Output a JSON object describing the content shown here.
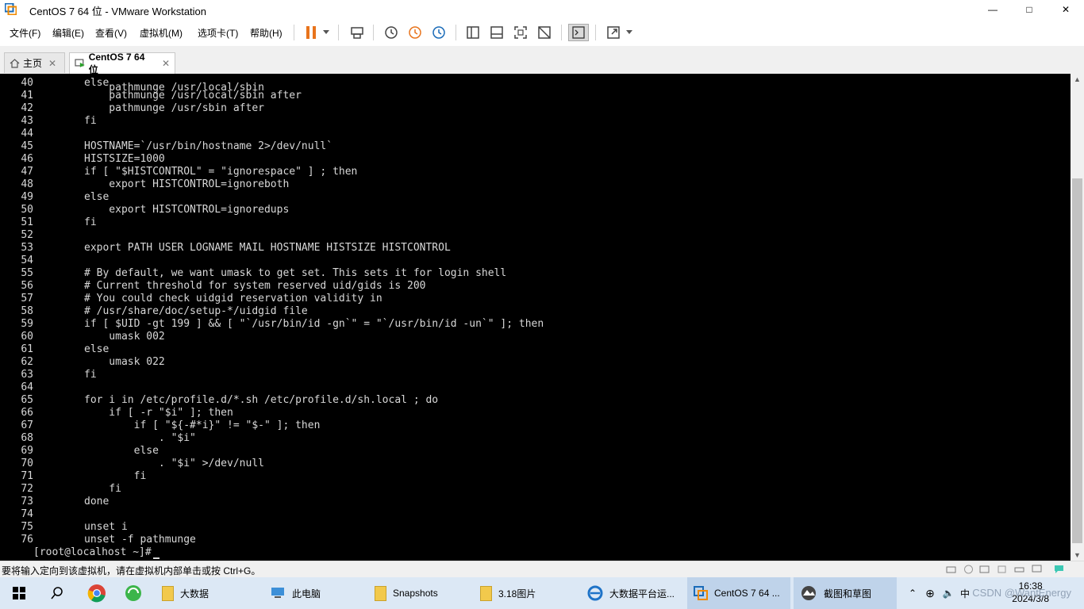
{
  "window": {
    "title": "CentOS 7 64 位 - VMware Workstation",
    "minimize": "—",
    "maximize": "□",
    "close": "✕"
  },
  "menu": [
    "文件(F)",
    "编辑(E)",
    "查看(V)",
    "虚拟机(M)",
    "选项卡(T)",
    "帮助(H)"
  ],
  "tabs": {
    "home": "主页",
    "vm": "CentOS 7 64 位"
  },
  "console": {
    "lines": [
      {
        "n": "40",
        "t": "else"
      },
      {
        "n": "41",
        "t": "    pathmunge /usr/local/sbin after"
      },
      {
        "n": "42",
        "t": "    pathmunge /usr/sbin after"
      },
      {
        "n": "43",
        "t": "fi"
      },
      {
        "n": "44",
        "t": ""
      },
      {
        "n": "45",
        "t": "HOSTNAME=`/usr/bin/hostname 2>/dev/null`"
      },
      {
        "n": "46",
        "t": "HISTSIZE=1000"
      },
      {
        "n": "47",
        "t": "if [ \"$HISTCONTROL\" = \"ignorespace\" ] ; then"
      },
      {
        "n": "48",
        "t": "    export HISTCONTROL=ignoreboth"
      },
      {
        "n": "49",
        "t": "else"
      },
      {
        "n": "50",
        "t": "    export HISTCONTROL=ignoredups"
      },
      {
        "n": "51",
        "t": "fi"
      },
      {
        "n": "52",
        "t": ""
      },
      {
        "n": "53",
        "t": "export PATH USER LOGNAME MAIL HOSTNAME HISTSIZE HISTCONTROL"
      },
      {
        "n": "54",
        "t": ""
      },
      {
        "n": "55",
        "t": "# By default, we want umask to get set. This sets it for login shell"
      },
      {
        "n": "56",
        "t": "# Current threshold for system reserved uid/gids is 200"
      },
      {
        "n": "57",
        "t": "# You could check uidgid reservation validity in"
      },
      {
        "n": "58",
        "t": "# /usr/share/doc/setup-*/uidgid file"
      },
      {
        "n": "59",
        "t": "if [ $UID -gt 199 ] && [ \"`/usr/bin/id -gn`\" = \"`/usr/bin/id -un`\" ]; then"
      },
      {
        "n": "60",
        "t": "    umask 002"
      },
      {
        "n": "61",
        "t": "else"
      },
      {
        "n": "62",
        "t": "    umask 022"
      },
      {
        "n": "63",
        "t": "fi"
      },
      {
        "n": "64",
        "t": ""
      },
      {
        "n": "65",
        "t": "for i in /etc/profile.d/*.sh /etc/profile.d/sh.local ; do"
      },
      {
        "n": "66",
        "t": "    if [ -r \"$i\" ]; then"
      },
      {
        "n": "67",
        "t": "        if [ \"${-#*i}\" != \"$-\" ]; then"
      },
      {
        "n": "68",
        "t": "            . \"$i\""
      },
      {
        "n": "69",
        "t": "        else"
      },
      {
        "n": "70",
        "t": "            . \"$i\" >/dev/null"
      },
      {
        "n": "71",
        "t": "        fi"
      },
      {
        "n": "72",
        "t": "    fi"
      },
      {
        "n": "73",
        "t": "done"
      },
      {
        "n": "74",
        "t": ""
      },
      {
        "n": "75",
        "t": "unset i"
      },
      {
        "n": "76",
        "t": "unset -f pathmunge"
      }
    ],
    "prompt": "[root@localhost ~]#"
  },
  "status": {
    "text": "要将输入定向到该虚拟机，请在虚拟机内部单击或按 Ctrl+G。"
  },
  "taskbar": {
    "items": [
      {
        "label": "大数据"
      },
      {
        "label": "此电脑"
      },
      {
        "label": "Snapshots"
      },
      {
        "label": "3.18图片"
      },
      {
        "label": "大数据平台运..."
      },
      {
        "label": "CentOS 7 64 ..."
      },
      {
        "label": "截图和草图"
      }
    ],
    "time": "16:38",
    "date": "2024/3/8",
    "watermark": "CSDN @WantEnergy",
    "ime": "中"
  },
  "colors": {
    "console_bg": "#000000",
    "console_fg": "#d8d8d8",
    "taskbar_bg": "#dce8f5",
    "pause_orange": "#e8741c"
  }
}
